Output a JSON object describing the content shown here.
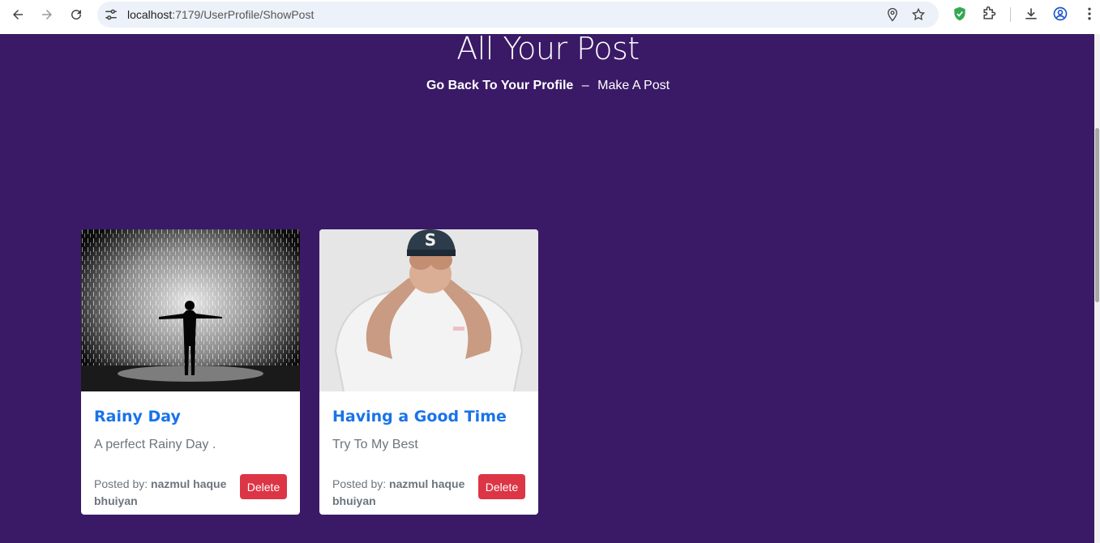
{
  "browser": {
    "url_host": "localhost",
    "url_rest": ":7179/UserProfile/ShowPost"
  },
  "page": {
    "title": "All Your Post",
    "back_link": "Go Back To Your Profile",
    "separator": "–",
    "make_post_link": "Make A Post"
  },
  "posts": [
    {
      "title": "Rainy Day",
      "description": "A perfect Rainy Day .",
      "posted_by_label": "Posted by:",
      "author": "nazmul haque bhuiyan",
      "delete_label": "Delete"
    },
    {
      "title": "Having a Good Time",
      "description": "Try To My Best",
      "posted_by_label": "Posted by:",
      "author": "nazmul haque bhuiyan",
      "delete_label": "Delete"
    }
  ],
  "colors": {
    "background": "#3a1a66",
    "title_blue": "#1a73e8",
    "delete_red": "#dc3545"
  }
}
